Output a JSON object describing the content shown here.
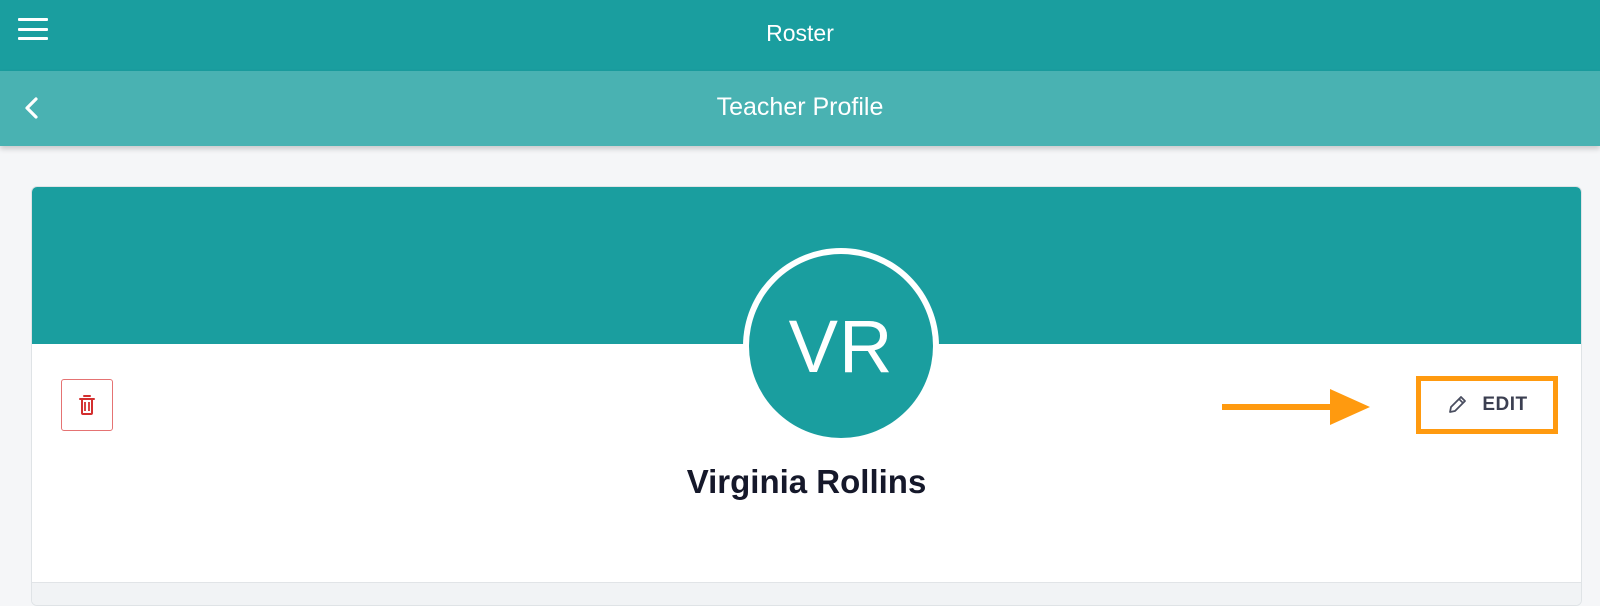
{
  "topbar": {
    "title": "Roster",
    "menu_icon": "hamburger-menu-icon"
  },
  "subbar": {
    "title": "Teacher Profile",
    "back_icon": "chevron-left-icon"
  },
  "profile": {
    "initials": "VR",
    "name": "Virginia Rollins",
    "delete_icon": "trash-icon",
    "edit_label": "EDIT",
    "edit_icon": "pencil-icon"
  },
  "colors": {
    "primary": "#1a9e9f",
    "secondary": "#49b2b2",
    "highlight": "#ff9a0f",
    "danger": "#d32f2f"
  }
}
